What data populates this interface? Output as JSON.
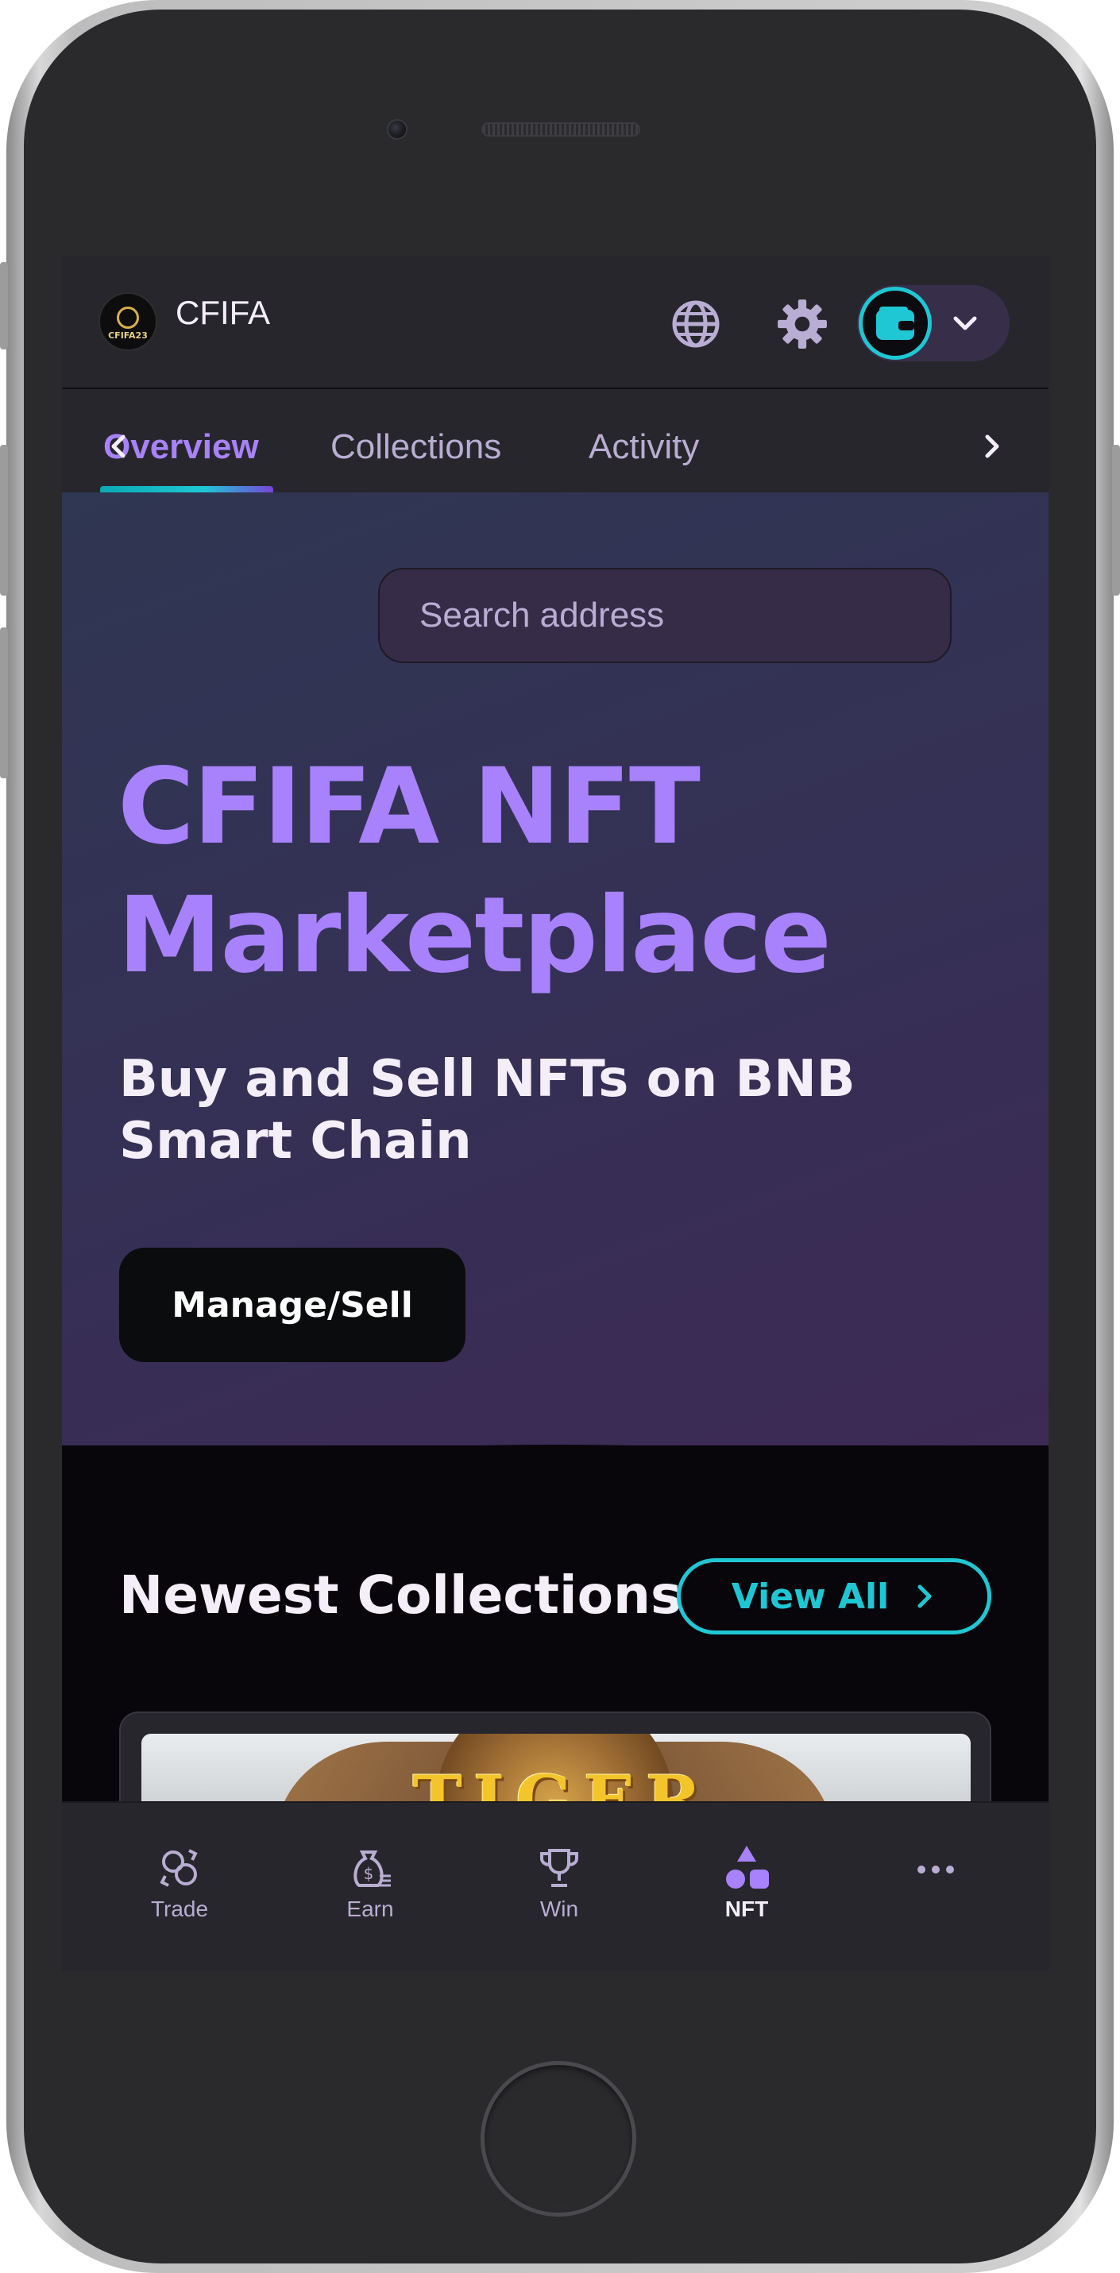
{
  "app": {
    "brand_name": "CFIFA",
    "logo_text": "CFIFA23"
  },
  "tabs": [
    {
      "label": "Overview",
      "active": true
    },
    {
      "label": "Collections",
      "active": false
    },
    {
      "label": "Activity",
      "active": false
    }
  ],
  "search": {
    "placeholder": "Search address"
  },
  "hero": {
    "title": "CFIFA NFT Marketplace",
    "subtitle": "Buy and Sell NFTs on BNB Smart Chain",
    "manage_button": "Manage/Sell"
  },
  "newest": {
    "title": "Newest Collections",
    "view_all": "View All",
    "card_image_text": "TIGER WARRIORS"
  },
  "bottom_nav": [
    {
      "label": "Trade",
      "icon": "trade-icon",
      "active": false
    },
    {
      "label": "Earn",
      "icon": "earn-icon",
      "active": false
    },
    {
      "label": "Win",
      "icon": "trophy-icon",
      "active": false
    },
    {
      "label": "NFT",
      "icon": "nft-icon",
      "active": true
    },
    {
      "label": "",
      "icon": "more-icon",
      "active": false
    }
  ],
  "colors": {
    "primary": "#a881fc",
    "accent": "#1fc7d4",
    "surface": "#27262c",
    "background": "#08060b",
    "text": "#f4eef8",
    "text_subtle": "#b8add2"
  }
}
